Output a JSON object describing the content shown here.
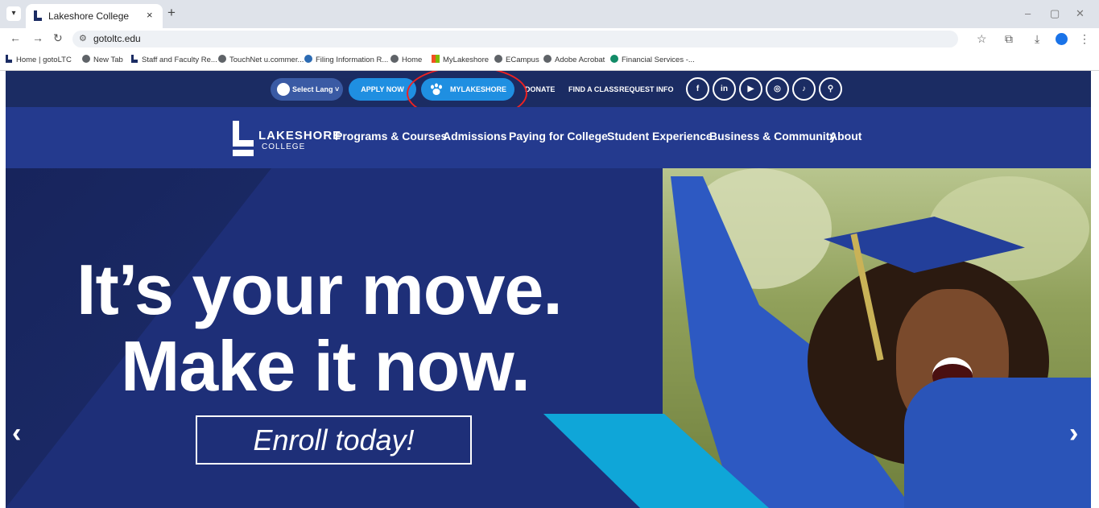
{
  "browser": {
    "tab_menu_icon": "chevron-down",
    "tab_title": "Lakeshore College",
    "tab_close": "×",
    "new_tab": "+",
    "url": "gotoltc.edu",
    "window_controls": [
      "–",
      "▢",
      "✕"
    ]
  },
  "bookmarks": [
    {
      "label": "Home | gotoLTC",
      "icon": "ltc-logo"
    },
    {
      "label": "New Tab",
      "icon": "globe"
    },
    {
      "label": "Staff and Faculty Re...",
      "icon": "ltc-logo"
    },
    {
      "label": "TouchNet u.commer...",
      "icon": "globe"
    },
    {
      "label": "Filing Information R...",
      "icon": "touchnet"
    },
    {
      "label": "Home",
      "icon": "globe"
    },
    {
      "label": "MyLakeshore",
      "icon": "microsoft"
    },
    {
      "label": "ECampus",
      "icon": "globe"
    },
    {
      "label": "Adobe Acrobat",
      "icon": "globe"
    },
    {
      "label": "Financial Services -...",
      "icon": "sharepoint"
    }
  ],
  "utility": {
    "language": "Select Lang",
    "apply": "APPLY NOW",
    "mylakeshore": "MYLAKESHORE",
    "donate": "DONATE",
    "find_class": "FIND A CLASS",
    "request_info": "REQUEST INFO",
    "social": [
      "f",
      "in",
      "▶",
      "◎",
      "♪",
      "⚲"
    ]
  },
  "logo": {
    "line1": "LAKESHORE",
    "line2": "COLLEGE"
  },
  "nav": [
    "Programs & Courses",
    "Admissions",
    "Paying for College",
    "Student Experience",
    "Business & Community",
    "About"
  ],
  "hero": {
    "line1": "It’s your move.",
    "line2": "Make it now.",
    "cta": "Enroll today!",
    "prev": "‹",
    "next": "›"
  },
  "colors": {
    "utility_bg": "#1b2c63",
    "nav_bg": "#243a8e",
    "accent": "#1f8fe1",
    "teal": "#0fa6d8",
    "annotation": "#e22222"
  }
}
